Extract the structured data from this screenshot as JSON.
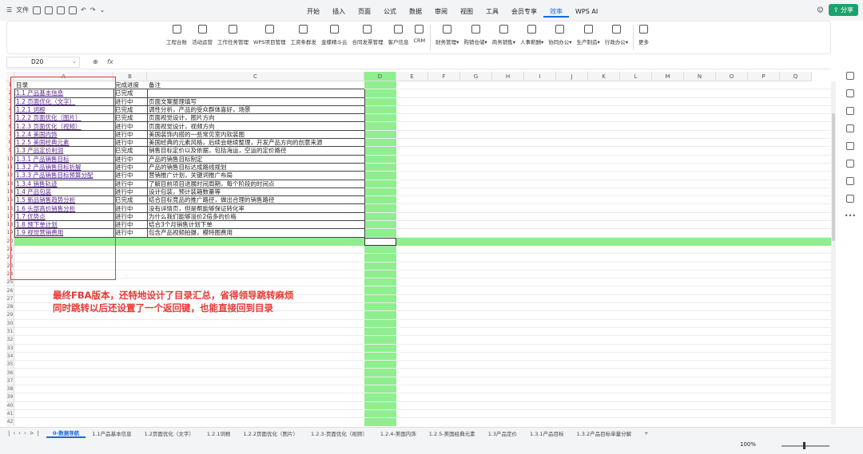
{
  "menubar": {
    "file": "文件",
    "menus": [
      "开始",
      "插入",
      "页面",
      "公式",
      "数据",
      "审阅",
      "视图",
      "工具",
      "会员专享",
      "效率",
      "WPS AI"
    ],
    "active_menu": "效率",
    "share": "分享"
  },
  "ribbon": {
    "items": [
      "工程台账",
      "活动运营",
      "工作任务管理",
      "WPS项目管理",
      "工资条群发",
      "金蝶精斗云",
      "合同发票管理",
      "客户信息",
      "CRM",
      "财务管理▾",
      "购销仓储▾",
      "商务销售▾",
      "人事薪酬▾",
      "协同办公▾",
      "生产制造▾",
      "行政办公▾",
      "更多"
    ]
  },
  "formula": {
    "cell_ref": "D20",
    "fx": "fx"
  },
  "columns": [
    "A",
    "B",
    "C",
    "D",
    "E",
    "F",
    "G",
    "H",
    "I",
    "J",
    "K",
    "L",
    "M",
    "N",
    "O",
    "P",
    "Q"
  ],
  "header_row": {
    "a": "目录",
    "b": "完成进度",
    "c": "备注"
  },
  "rows": [
    {
      "a": "1.1 产品基本信息",
      "b": "已完成",
      "c": ""
    },
    {
      "a": "1.2 页面优化（文字）",
      "b": "进行中",
      "c": "页面文案整理填写"
    },
    {
      "a": "1.2.1 词根",
      "b": "已完成",
      "c": "调性分析，产品的受众群体喜好，场景"
    },
    {
      "a": "1.2.2 页面优化（图片）",
      "b": "已完成",
      "c": "页面视觉设计，图片方向"
    },
    {
      "a": "1.2.3 页面优化（视频）",
      "b": "进行中",
      "c": "页面视觉设计，视频方向"
    },
    {
      "a": "1.2.4 美国内饰",
      "b": "进行中",
      "c": "美国装饰内搭的一些常见室内软装图"
    },
    {
      "a": "1.2.5 美国经典元素",
      "b": "进行中",
      "c": "美国经典的元素风格，后续会继续整理，开发产品方向的创意来源"
    },
    {
      "a": "1.3 产品定价利润",
      "b": "已完成",
      "c": "销售目标定价以及依据，包括海运，空运的定价路径"
    },
    {
      "a": "1.3.1 产品销售目标",
      "b": "进行中",
      "c": "产品的销售目标制定"
    },
    {
      "a": "1.3.2 产品销售目标折解",
      "b": "进行中",
      "c": "产品的销售目标达成路线规划"
    },
    {
      "a": "1.3.3 产品销售目标预算分配",
      "b": "进行中",
      "c": "营销推广计划，关键词推广布局"
    },
    {
      "a": "1.3.4 销售轨迹",
      "b": "进行中",
      "c": "了解目前项目进展时间周期，每个阶段的时间点"
    },
    {
      "a": "1.4 产品包装",
      "b": "进行中",
      "c": "设计包装，预计装箱数量等"
    },
    {
      "a": "1.5 新品销售趋势分析",
      "b": "已完成",
      "c": "结合目标竞品的推广路径，做出合理的销售路径"
    },
    {
      "a": "1.6 头部高价销售分析",
      "b": "进行中",
      "c": "没有详情页，但是帮能够保证转化率"
    },
    {
      "a": "1.7 优势点",
      "b": "进行中",
      "c": "为什么我们能够溢价2倍多的价格"
    },
    {
      "a": "1.8 预下单计划",
      "b": "进行中",
      "c": "结合3个月销售计划下单"
    },
    {
      "a": "1.9 视觉营销费用",
      "b": "进行中",
      "c": "包含产品视频拍摄，模特图费用"
    }
  ],
  "row_numbers": [
    "1",
    "2",
    "3",
    "4",
    "5",
    "6",
    "7",
    "8",
    "9",
    "10",
    "11",
    "12",
    "13",
    "14",
    "15",
    "16",
    "17",
    "18",
    "19",
    "20",
    "21",
    "22",
    "23",
    "24",
    "25",
    "26",
    "27",
    "28",
    "29",
    "30",
    "31",
    "32",
    "33",
    "34",
    "35",
    "36",
    "37",
    "38",
    "39",
    "40",
    "41",
    "42"
  ],
  "note": {
    "line1": "最终FBA版本，还特地设计了目录汇总，省得领导跳转麻烦",
    "line2": "同时跳转以后还设置了一个返回键，也能直接回到目录"
  },
  "tabs": {
    "items": [
      "0-数据导航",
      "1.1产品基本信息",
      "1.2页面优化（文字）",
      "1.2.1词根",
      "1.2.2页面优化（图片）",
      "1.2.3-页面优化（视频）",
      "1.2.4-美国内饰",
      "1.2.5-美国经典元素",
      "1.3产品定价",
      "1.3.1产品目标",
      "1.3.2产品目标单量分解"
    ],
    "active": "0-数据导航"
  },
  "status": {
    "zoom": "100%"
  },
  "colors": {
    "green": "#8fef8f",
    "red": "#e53935",
    "link": "#5a2a8a",
    "accent": "#1a6bd6"
  }
}
